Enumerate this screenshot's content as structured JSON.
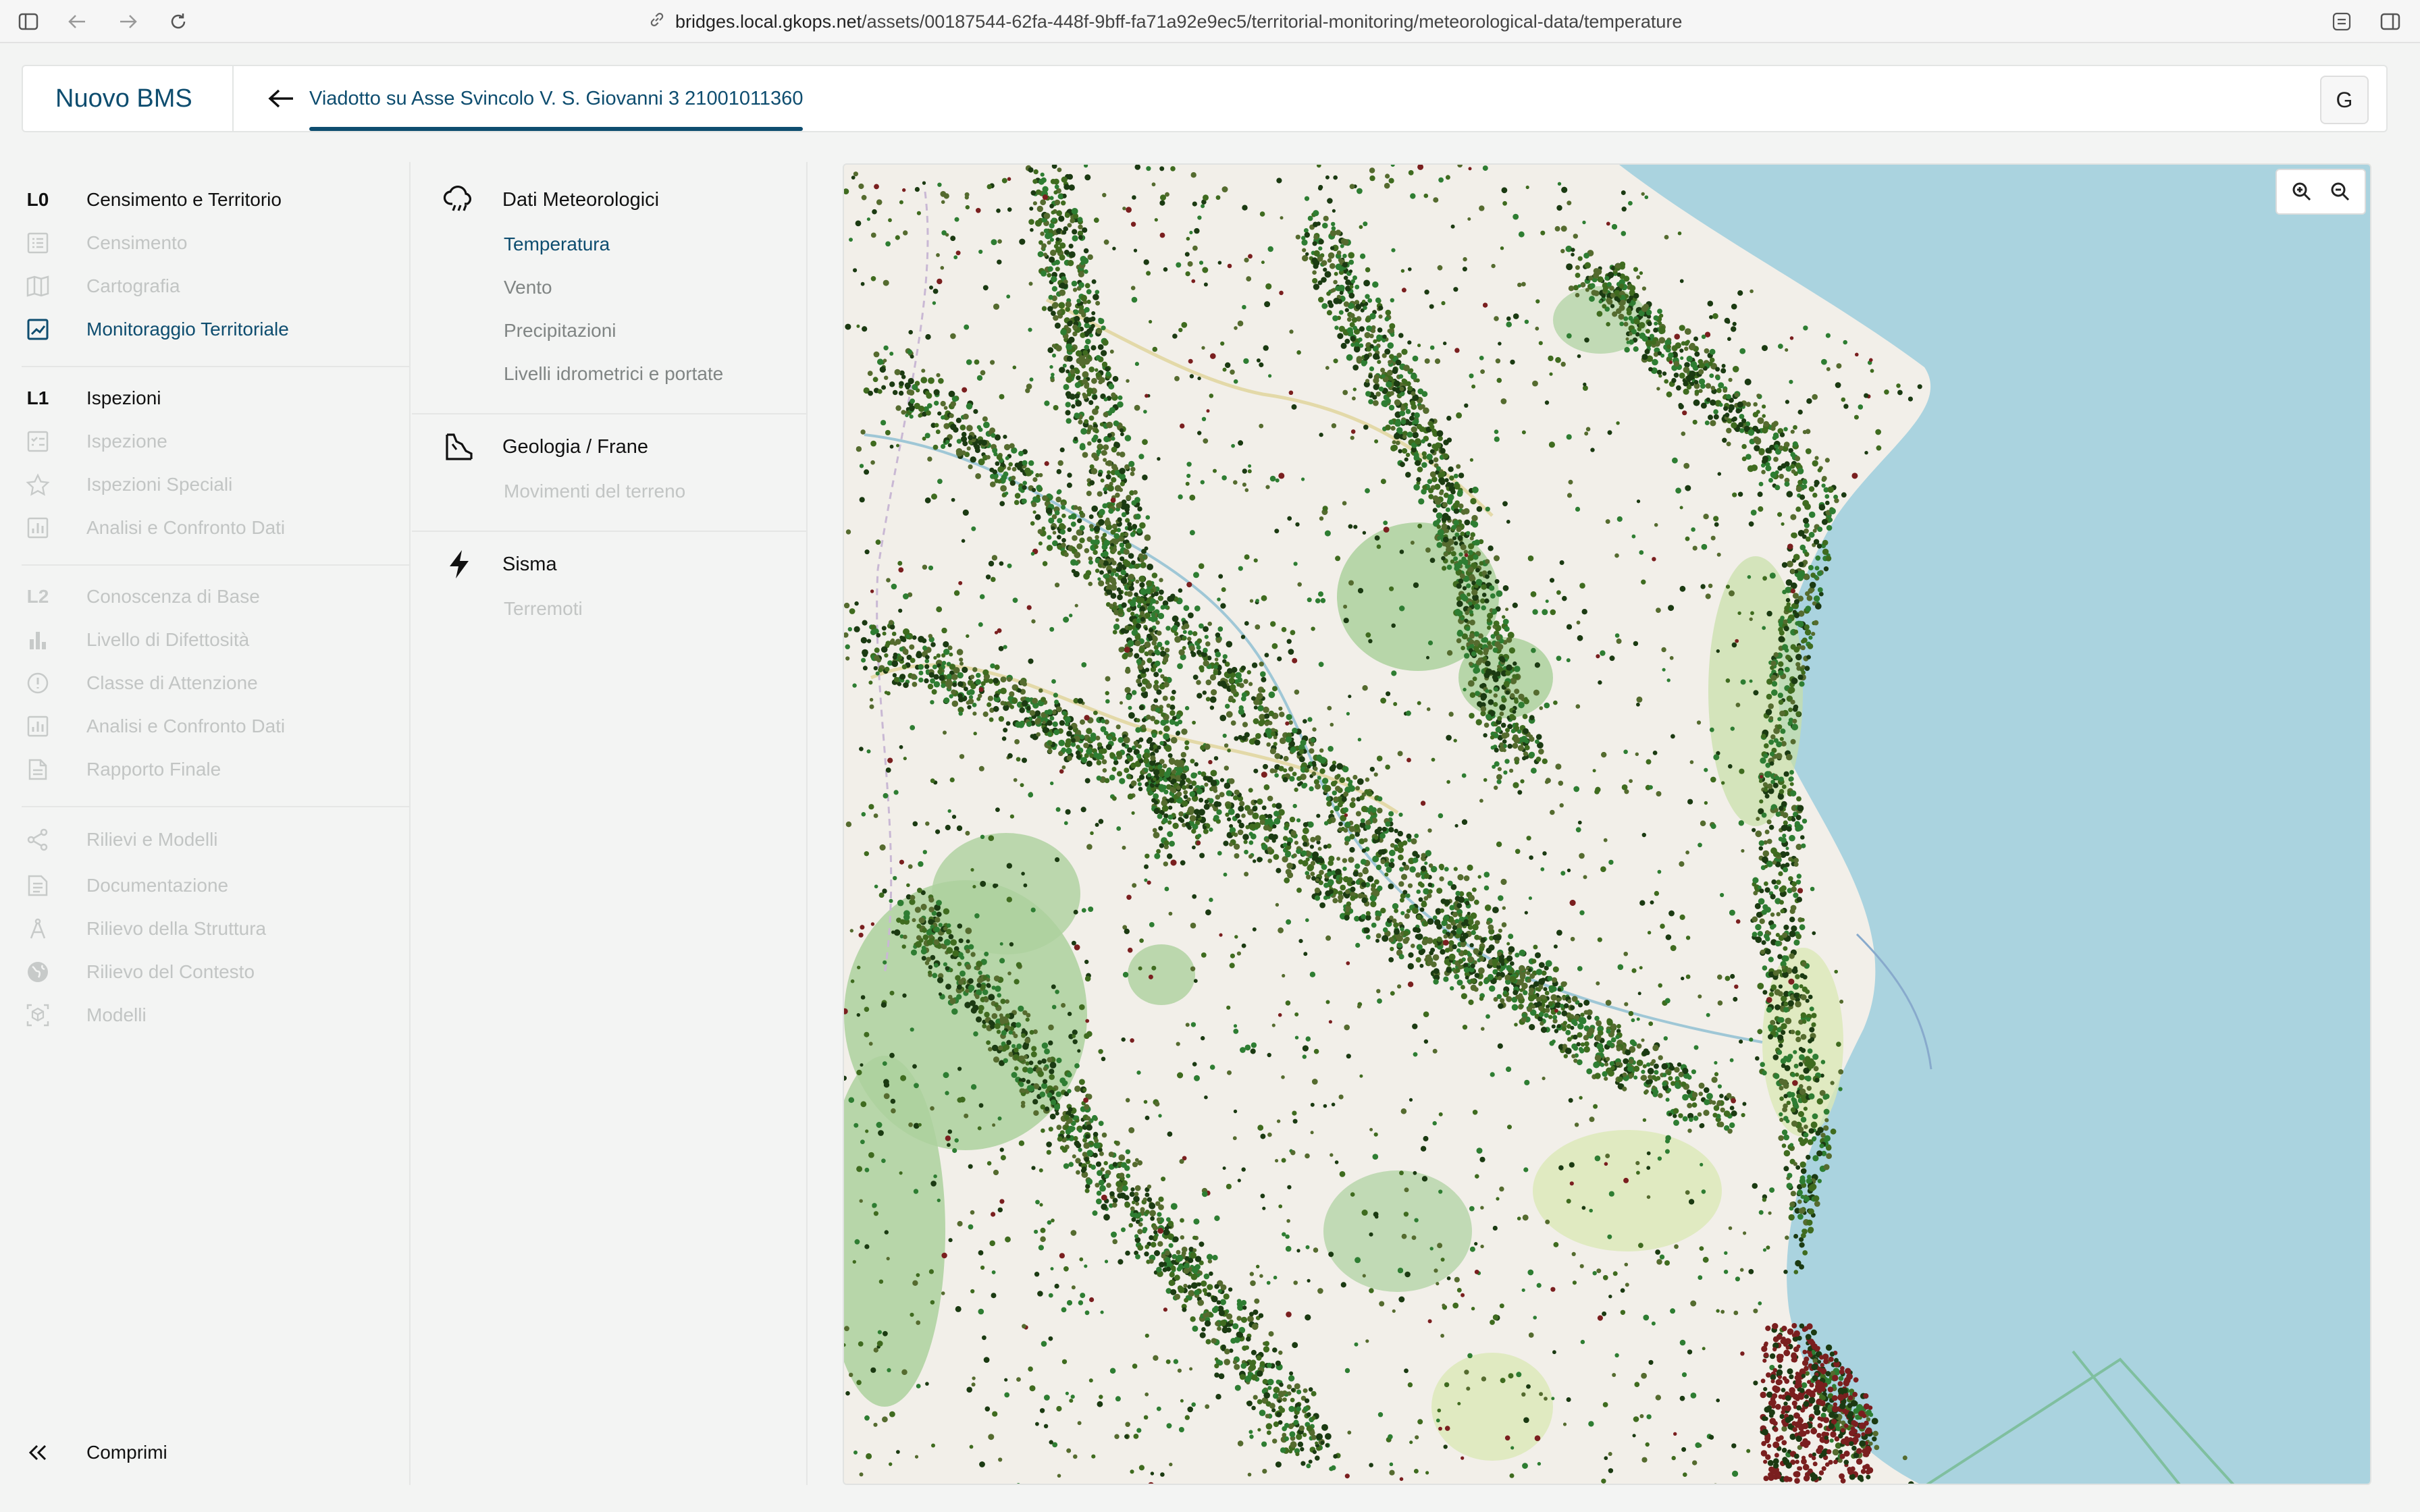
{
  "browser": {
    "url_host": "bridges.local.gkops.net",
    "url_path": "/assets/00187544-62fa-448f-9bff-fa71a92e9ec5/territorial-monitoring/meteorological-data/temperature"
  },
  "header": {
    "brand": "Nuovo BMS",
    "bridge_title": "Viadotto su Asse Svincolo V. S. Giovanni 3 21001011360",
    "user_initial": "G"
  },
  "sidebar": {
    "groups": [
      {
        "level": "L0",
        "title": "Censimento e Territorio",
        "items": [
          "Censimento",
          "Cartografia",
          "Monitoraggio Territoriale"
        ]
      },
      {
        "level": "L1",
        "title": "Ispezioni",
        "items": [
          "Ispezione",
          "Ispezioni Speciali",
          "Analisi e Confronto Dati"
        ]
      },
      {
        "level": "L2",
        "title": "Conoscenza di Base",
        "items": [
          "Livello di Difettosità",
          "Classe di Attenzione",
          "Analisi e Confronto Dati",
          "Rapporto Finale"
        ]
      },
      {
        "level": "",
        "title": "",
        "items": [
          "Rilievi e Modelli",
          "Documentazione",
          "Rilievo della Struttura",
          "Rilievo del Contesto",
          "Modelli"
        ]
      }
    ],
    "collapse_label": "Comprimi"
  },
  "submenu": {
    "sections": [
      {
        "title": "Dati Meteorologici",
        "items": [
          "Temperatura",
          "Vento",
          "Precipitazioni",
          "Livelli idrometrici e portate"
        ]
      },
      {
        "title": "Geologia / Frane",
        "items": [
          "Movimenti del terreno"
        ]
      },
      {
        "title": "Sisma",
        "items": [
          "Terremoti"
        ]
      }
    ]
  },
  "map": {
    "zoom_in_icon": "zoom-in-icon",
    "zoom_out_icon": "zoom-out-icon",
    "colors": {
      "sea": "#aad3df",
      "land": "#f2efe9",
      "forest": "#add19e",
      "points_green": "#2e7d32",
      "points_dark": "#1b3a12",
      "points_red": "#7a1f1f"
    }
  },
  "colors": {
    "accent": "#0e4d6f"
  }
}
